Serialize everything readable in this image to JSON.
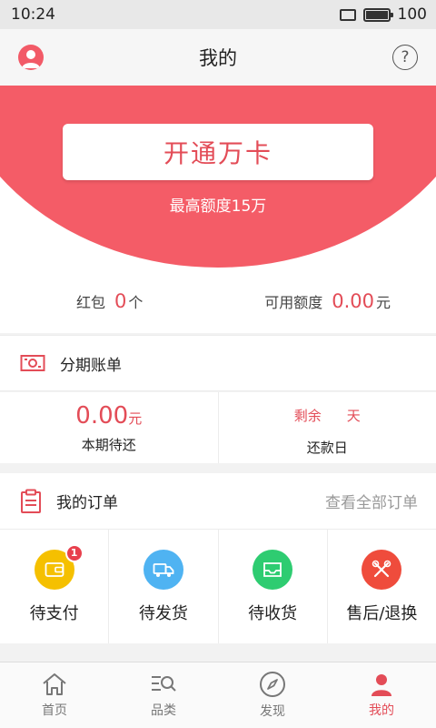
{
  "statusbar": {
    "time": "10:24",
    "battery": "100"
  },
  "header": {
    "title": "我的"
  },
  "hero": {
    "open_card_label": "开通万卡",
    "credit_line": "最高额度15万"
  },
  "summary": {
    "red_packet_label": "红包",
    "red_packet_value": "0",
    "red_packet_unit": "个",
    "available_label": "可用额度",
    "available_value": "0.00",
    "available_unit": "元"
  },
  "installment": {
    "title": "分期账单",
    "current_amount": "0.00",
    "current_unit": "元",
    "current_label": "本期待还",
    "remain_prefix": "剩余",
    "remain_suffix": "天",
    "due_label": "还款日"
  },
  "orders": {
    "title": "我的订单",
    "view_all": "查看全部订单",
    "items": [
      {
        "label": "待支付",
        "badge": "1",
        "color": "#f5c000"
      },
      {
        "label": "待发货",
        "color": "#4fb3f2"
      },
      {
        "label": "待收货",
        "color": "#2ecc71"
      },
      {
        "label": "售后/退换",
        "color": "#ef4c3c"
      }
    ]
  },
  "tabbar": {
    "items": [
      {
        "label": "首页",
        "icon": "home-icon"
      },
      {
        "label": "品类",
        "icon": "category-search-icon"
      },
      {
        "label": "发现",
        "icon": "compass-icon"
      },
      {
        "label": "我的",
        "icon": "person-icon",
        "active": true
      }
    ]
  },
  "colors": {
    "accent": "#e34c57",
    "hero_bg": "#f45c67"
  }
}
